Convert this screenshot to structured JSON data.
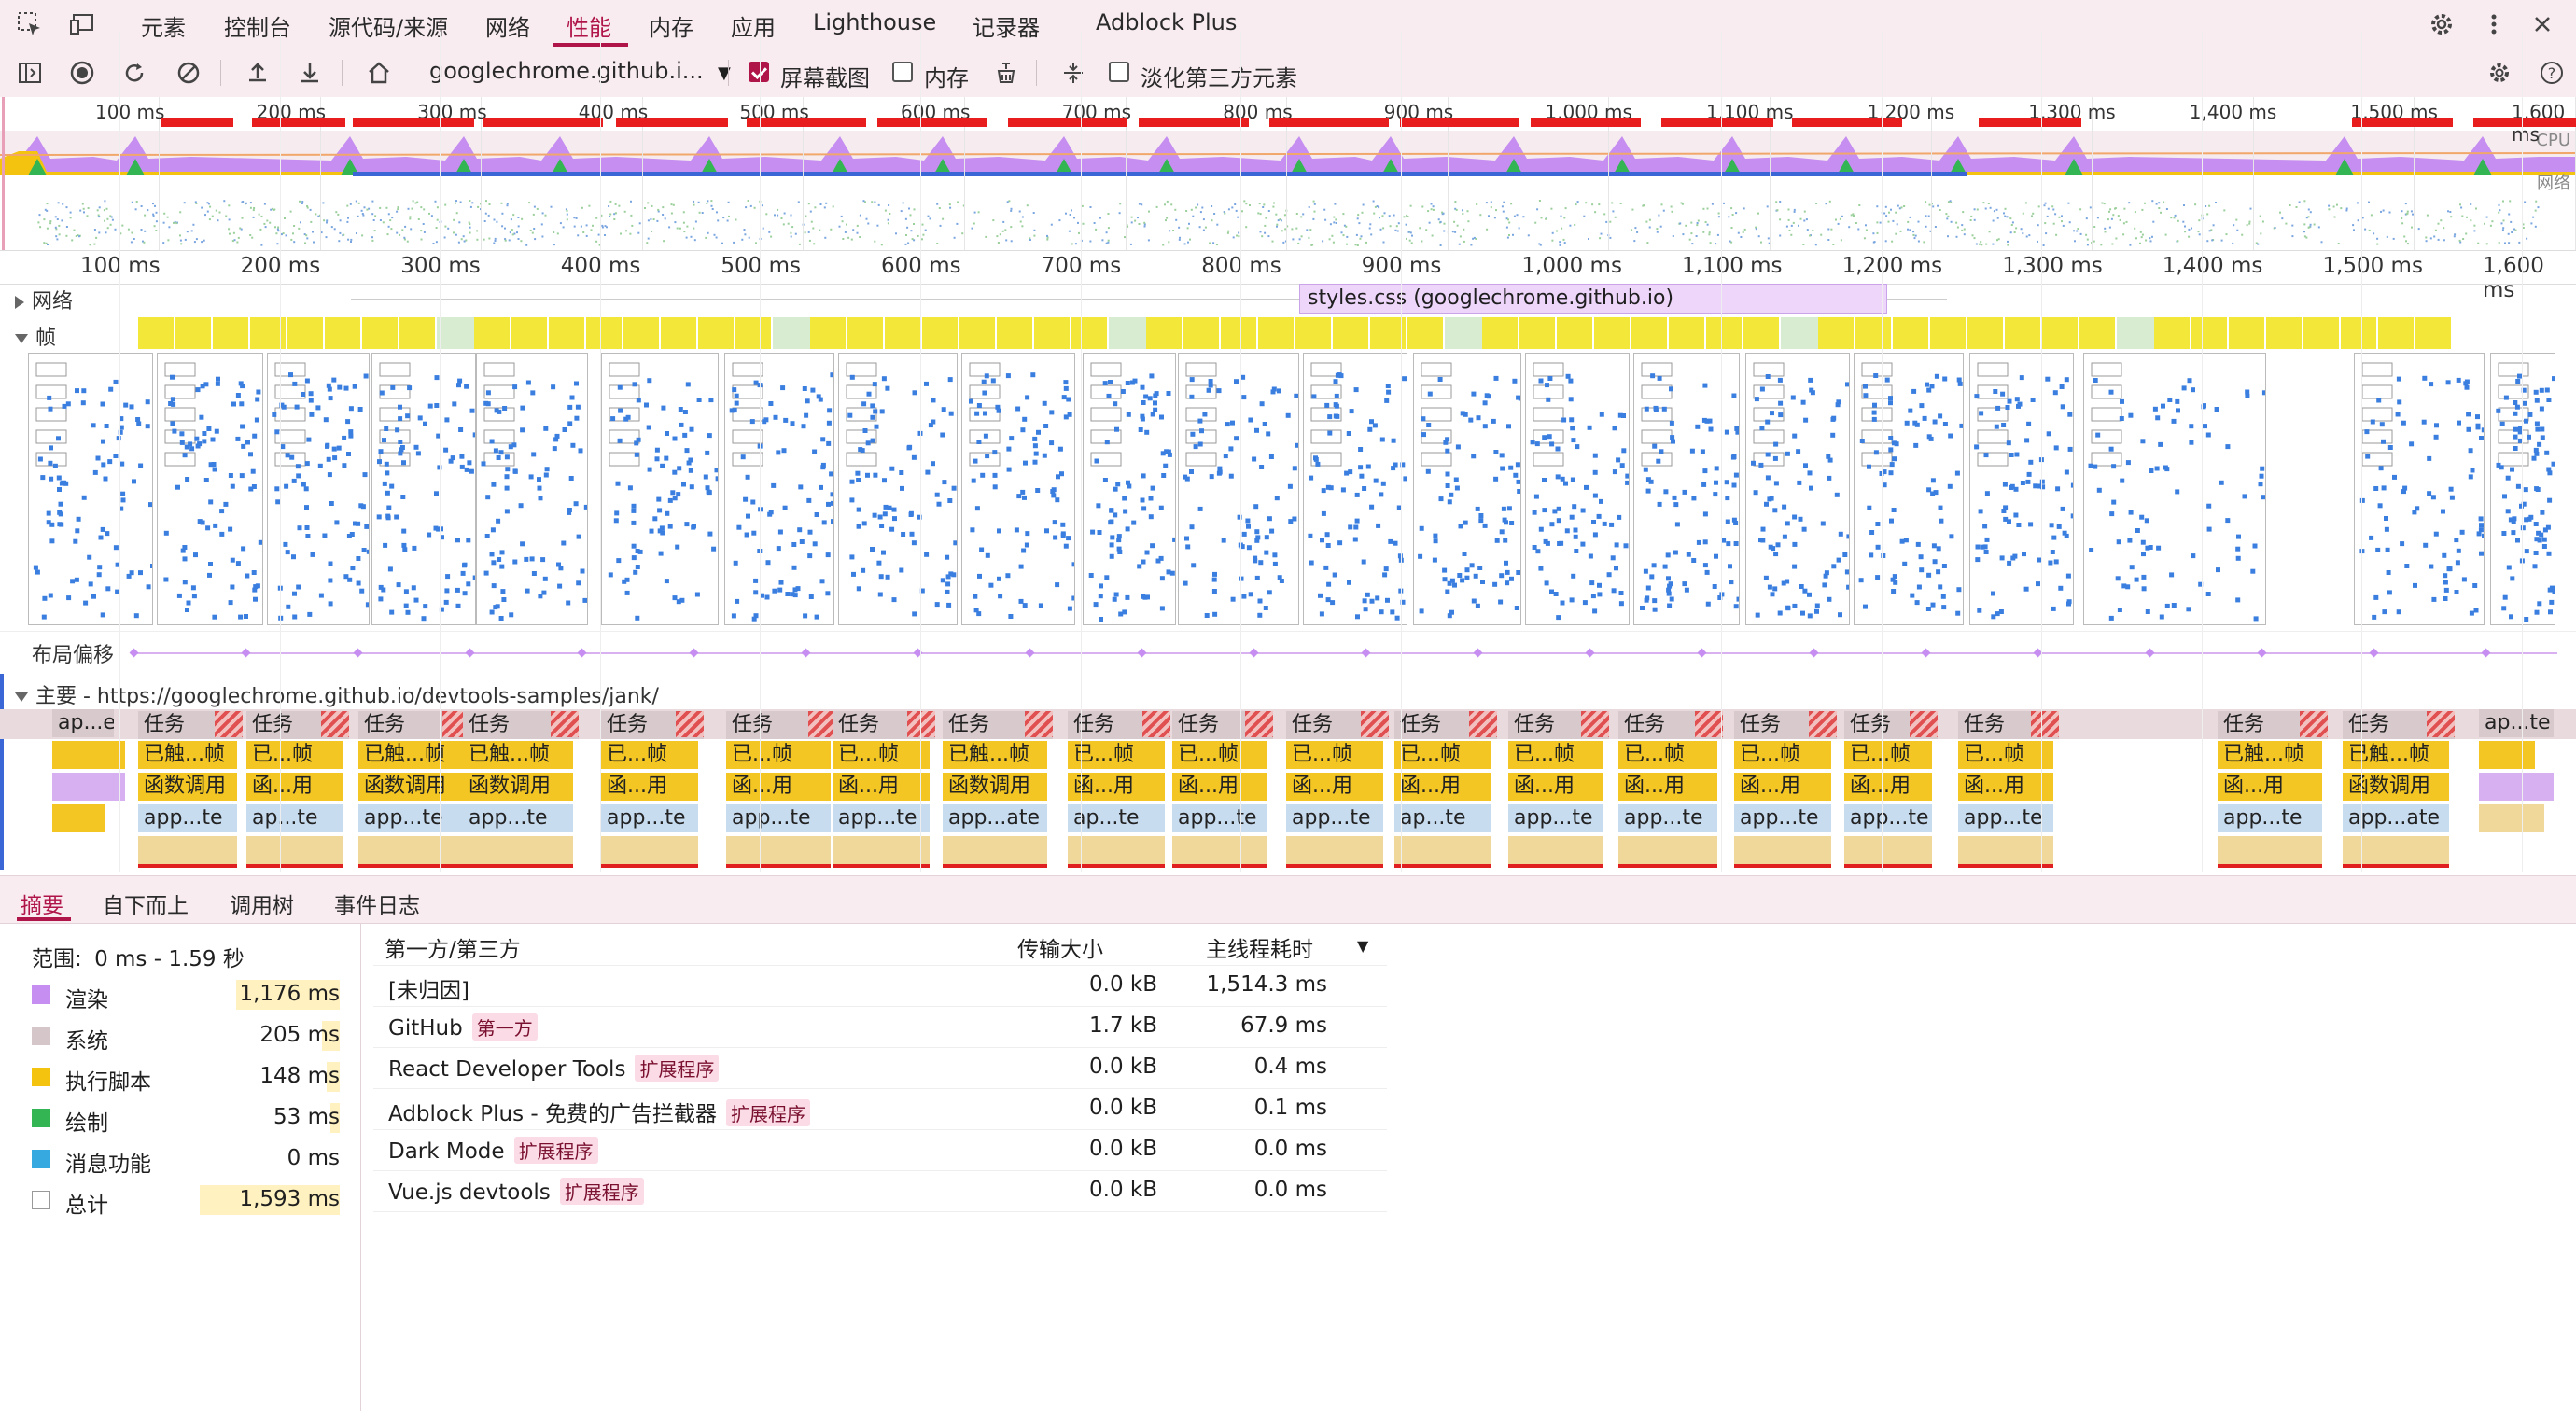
{
  "tabbar": {
    "tabs": [
      "元素",
      "控制台",
      "源代码/来源",
      "网络",
      "性能",
      "内存",
      "应用",
      "Lighthouse",
      "记录器",
      "Adblock Plus"
    ],
    "active_tab": "性能"
  },
  "toolbar": {
    "url_select": "googlechrome.github.i...",
    "screenshot_label": "屏幕截图",
    "screenshot_checked": true,
    "memory_label": "内存",
    "memory_checked": false,
    "dim_third_party_label": "淡化第三方元素",
    "dim_third_party_checked": false
  },
  "overview": {
    "ticks": [
      "100 ms",
      "200 ms",
      "300 ms",
      "400 ms",
      "500 ms",
      "600 ms",
      "700 ms",
      "800 ms",
      "900 ms",
      "1,000 ms",
      "1,100 ms",
      "1,200 ms",
      "1,300 ms",
      "1,400 ms",
      "1,500 ms",
      "1,600 ms"
    ],
    "cpu_label": "CPU",
    "net_label": "网络"
  },
  "ruler": {
    "ticks": [
      "100 ms",
      "200 ms",
      "300 ms",
      "400 ms",
      "500 ms",
      "600 ms",
      "700 ms",
      "800 ms",
      "900 ms",
      "1,000 ms",
      "1,100 ms",
      "1,200 ms",
      "1,300 ms",
      "1,400 ms",
      "1,500 ms",
      "1,600 ms"
    ]
  },
  "tracks": {
    "network_label": "网络",
    "network_request": "styles.css (googlechrome.github.io)",
    "frames_label": "帧",
    "layout_shift_label": "布局偏移",
    "main_label": "主要 - https://googlechrome.github.io/devtools-samples/jank/"
  },
  "main_tasks": {
    "first": "ap...e",
    "last": "ap...te",
    "task_label": "任务",
    "row2": [
      "已触...帧",
      "已...帧",
      "已触...帧",
      "已触...帧",
      "已...帧",
      "已...帧",
      "已...帧",
      "已触...帧",
      "已...帧",
      "已...帧",
      "已...帧",
      "已...帧",
      "已...帧",
      "已...帧",
      "已...帧",
      "已...帧",
      "已...帧",
      "已触...帧",
      "已触...帧"
    ],
    "row3": [
      "函数调用",
      "函...用",
      "函数调用",
      "函数调用",
      "函...用",
      "函...用",
      "函...用",
      "函数调用",
      "函...用",
      "函...用",
      "函...用",
      "函...用",
      "函...用",
      "函...用",
      "函...用",
      "函...用",
      "函...用",
      "函...用",
      "函数调用"
    ],
    "row4": [
      "app...te",
      "ap...te",
      "app...te",
      "app...te",
      "app...te",
      "app...te",
      "app...te",
      "app...ate",
      "ap...te",
      "app...te",
      "app...te",
      "ap...te",
      "app...te",
      "app...te",
      "app...te",
      "app...te",
      "app...te",
      "app...te",
      "app...ate"
    ]
  },
  "bottom_tabs": [
    "摘要",
    "自下而上",
    "调用树",
    "事件日志"
  ],
  "summary": {
    "range_label": "范围:",
    "range_value": "0 ms - 1.59 秒",
    "items": [
      {
        "label": "渲染",
        "value": "1,176 ms",
        "color": "#c58ef0"
      },
      {
        "label": "系统",
        "value": "205 ms",
        "color": "#d4c6c9"
      },
      {
        "label": "执行脚本",
        "value": "148 ms",
        "color": "#f4c30f"
      },
      {
        "label": "绘制",
        "value": "53 ms",
        "color": "#32b552"
      },
      {
        "label": "消息功能",
        "value": "0 ms",
        "color": "#36a9e0"
      },
      {
        "label": "总计",
        "value": "1,593 ms",
        "color": "#ffffff"
      }
    ]
  },
  "thirdparty": {
    "headers": {
      "name": "第一方/第三方",
      "size": "传输大小",
      "time": "主线程耗时"
    },
    "rows": [
      {
        "name": "[未归因]",
        "badge": "",
        "size": "0.0 kB",
        "time": "1,514.3 ms"
      },
      {
        "name": "GitHub",
        "badge": "第一方",
        "size": "1.7 kB",
        "time": "67.9 ms"
      },
      {
        "name": "React Developer Tools",
        "badge": "扩展程序",
        "size": "0.0 kB",
        "time": "0.4 ms"
      },
      {
        "name": "Adblock Plus - 免费的广告拦截器",
        "badge": "扩展程序",
        "size": "0.0 kB",
        "time": "0.1 ms"
      },
      {
        "name": "Dark Mode",
        "badge": "扩展程序",
        "size": "0.0 kB",
        "time": "0.0 ms"
      },
      {
        "name": "Vue.js devtools",
        "badge": "扩展程序",
        "size": "0.0 kB",
        "time": "0.0 ms"
      }
    ]
  }
}
